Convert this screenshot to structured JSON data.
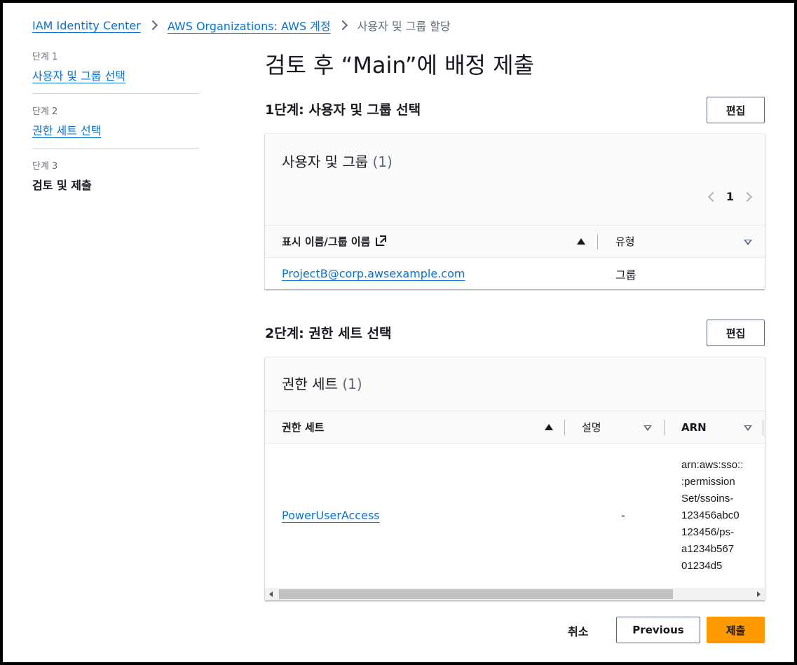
{
  "breadcrumb": {
    "items": [
      "IAM Identity Center",
      "AWS Organizations: AWS 계정"
    ],
    "current": "사용자 및 그룹 할당"
  },
  "steps": [
    {
      "num": "단계 1",
      "label": "사용자 및 그룹 선택"
    },
    {
      "num": "단계 2",
      "label": "권한 세트 선택"
    },
    {
      "num": "단계 3",
      "label": "검토 및 제출"
    }
  ],
  "page_title": "검토 후 “Main”에 배정 제출",
  "section1": {
    "title": "1단계: 사용자 및 그룹 선택",
    "edit": "편집",
    "container_title": "사용자 및 그룹",
    "count": "(1)",
    "page": "1",
    "columns": [
      "표시 이름/그룹 이름",
      "유형"
    ],
    "rows": [
      {
        "name": "ProjectB@corp.awsexample.com",
        "type": "그룹"
      }
    ]
  },
  "section2": {
    "title": "2단계: 권한 세트 선택",
    "edit": "편집",
    "container_title": "권한 세트",
    "count": "(1)",
    "columns": [
      "권한 세트",
      "설명",
      "ARN"
    ],
    "rows": [
      {
        "name": "PowerUserAccess",
        "description": "-",
        "arn_lines": [
          "arn:aws:sso::",
          ":permission",
          "Set/ssoins-",
          "123456abc0",
          "123456/ps-",
          "a1234b567",
          "01234d5"
        ]
      }
    ]
  },
  "footer": {
    "cancel": "취소",
    "previous": "Previous",
    "submit": "제출"
  },
  "colors": {
    "link": "#0972d3",
    "primary": "#ff9900",
    "text": "#16191f",
    "muted": "#5f6b7a"
  }
}
